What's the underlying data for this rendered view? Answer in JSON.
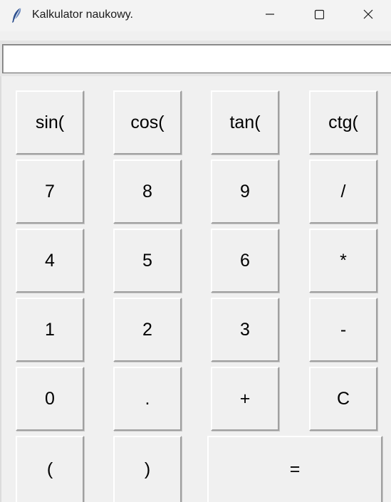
{
  "window": {
    "title": "Kalkulator naukowy.",
    "app_icon": "feather-icon",
    "controls": [
      "minimize-icon",
      "maximize-icon",
      "close-icon"
    ]
  },
  "display": {
    "value": ""
  },
  "keys": {
    "sin": "sin(",
    "cos": "cos(",
    "tan": "tan(",
    "ctg": "ctg(",
    "seven": "7",
    "eight": "8",
    "nine": "9",
    "divide": "/",
    "four": "4",
    "five": "5",
    "six": "6",
    "multiply": "*",
    "one": "1",
    "two": "2",
    "three": "3",
    "minus": "-",
    "zero": "0",
    "dot": ".",
    "plus": "+",
    "clear": "C",
    "lparen": "(",
    "rparen": ")",
    "equals": "="
  }
}
